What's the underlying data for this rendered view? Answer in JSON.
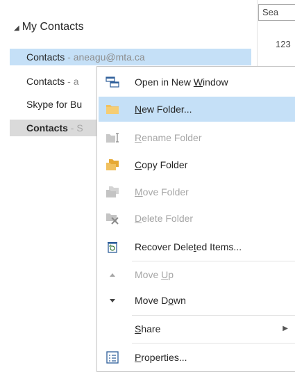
{
  "nav": {
    "group_label": "My Contacts",
    "folders": [
      {
        "name": "Contacts",
        "account": " - aneagu@mta.ca"
      },
      {
        "name": "Contacts",
        "account": " - a"
      },
      {
        "name": "Skype for Bu",
        "account": ""
      },
      {
        "name": "Contacts",
        "account": " - S"
      }
    ]
  },
  "right_pane": {
    "search_text": "Sea",
    "count_text": "123"
  },
  "context_menu": {
    "items": [
      {
        "pre": "Open in New ",
        "u": "W",
        "post": "indow",
        "icon": "open-window-icon",
        "disabled": false
      },
      {
        "pre": "",
        "u": "N",
        "post": "ew Folder...",
        "icon": "folder-icon",
        "disabled": false,
        "highlighted": true
      },
      {
        "pre": "",
        "u": "R",
        "post": "ename Folder",
        "icon": "rename-folder-icon",
        "disabled": true
      },
      {
        "pre": "",
        "u": "C",
        "post": "opy Folder",
        "icon": "copy-folder-icon",
        "disabled": false
      },
      {
        "pre": "",
        "u": "M",
        "post": "ove Folder",
        "icon": "move-folder-icon",
        "disabled": true
      },
      {
        "pre": "",
        "u": "D",
        "post": "elete Folder",
        "icon": "delete-folder-icon",
        "disabled": true
      },
      {
        "pre": "Recover Dele",
        "u": "t",
        "post": "ed Items...",
        "icon": "recover-items-icon",
        "disabled": false
      },
      {
        "pre": "Move ",
        "u": "U",
        "post": "p",
        "icon": "triangle-up-icon",
        "disabled": true
      },
      {
        "pre": "Move D",
        "u": "o",
        "post": "wn",
        "icon": "triangle-down-icon",
        "disabled": false
      },
      {
        "pre": "",
        "u": "S",
        "post": "hare",
        "icon": "",
        "disabled": false,
        "submenu": true
      },
      {
        "pre": "",
        "u": "P",
        "post": "roperties...",
        "icon": "properties-icon",
        "disabled": false
      }
    ]
  },
  "colors": {
    "selection": "#c5e0f7",
    "selected_gray": "#dadada",
    "disabled_text": "#a6a6a6",
    "folder_yellow": "#f1c15f"
  }
}
